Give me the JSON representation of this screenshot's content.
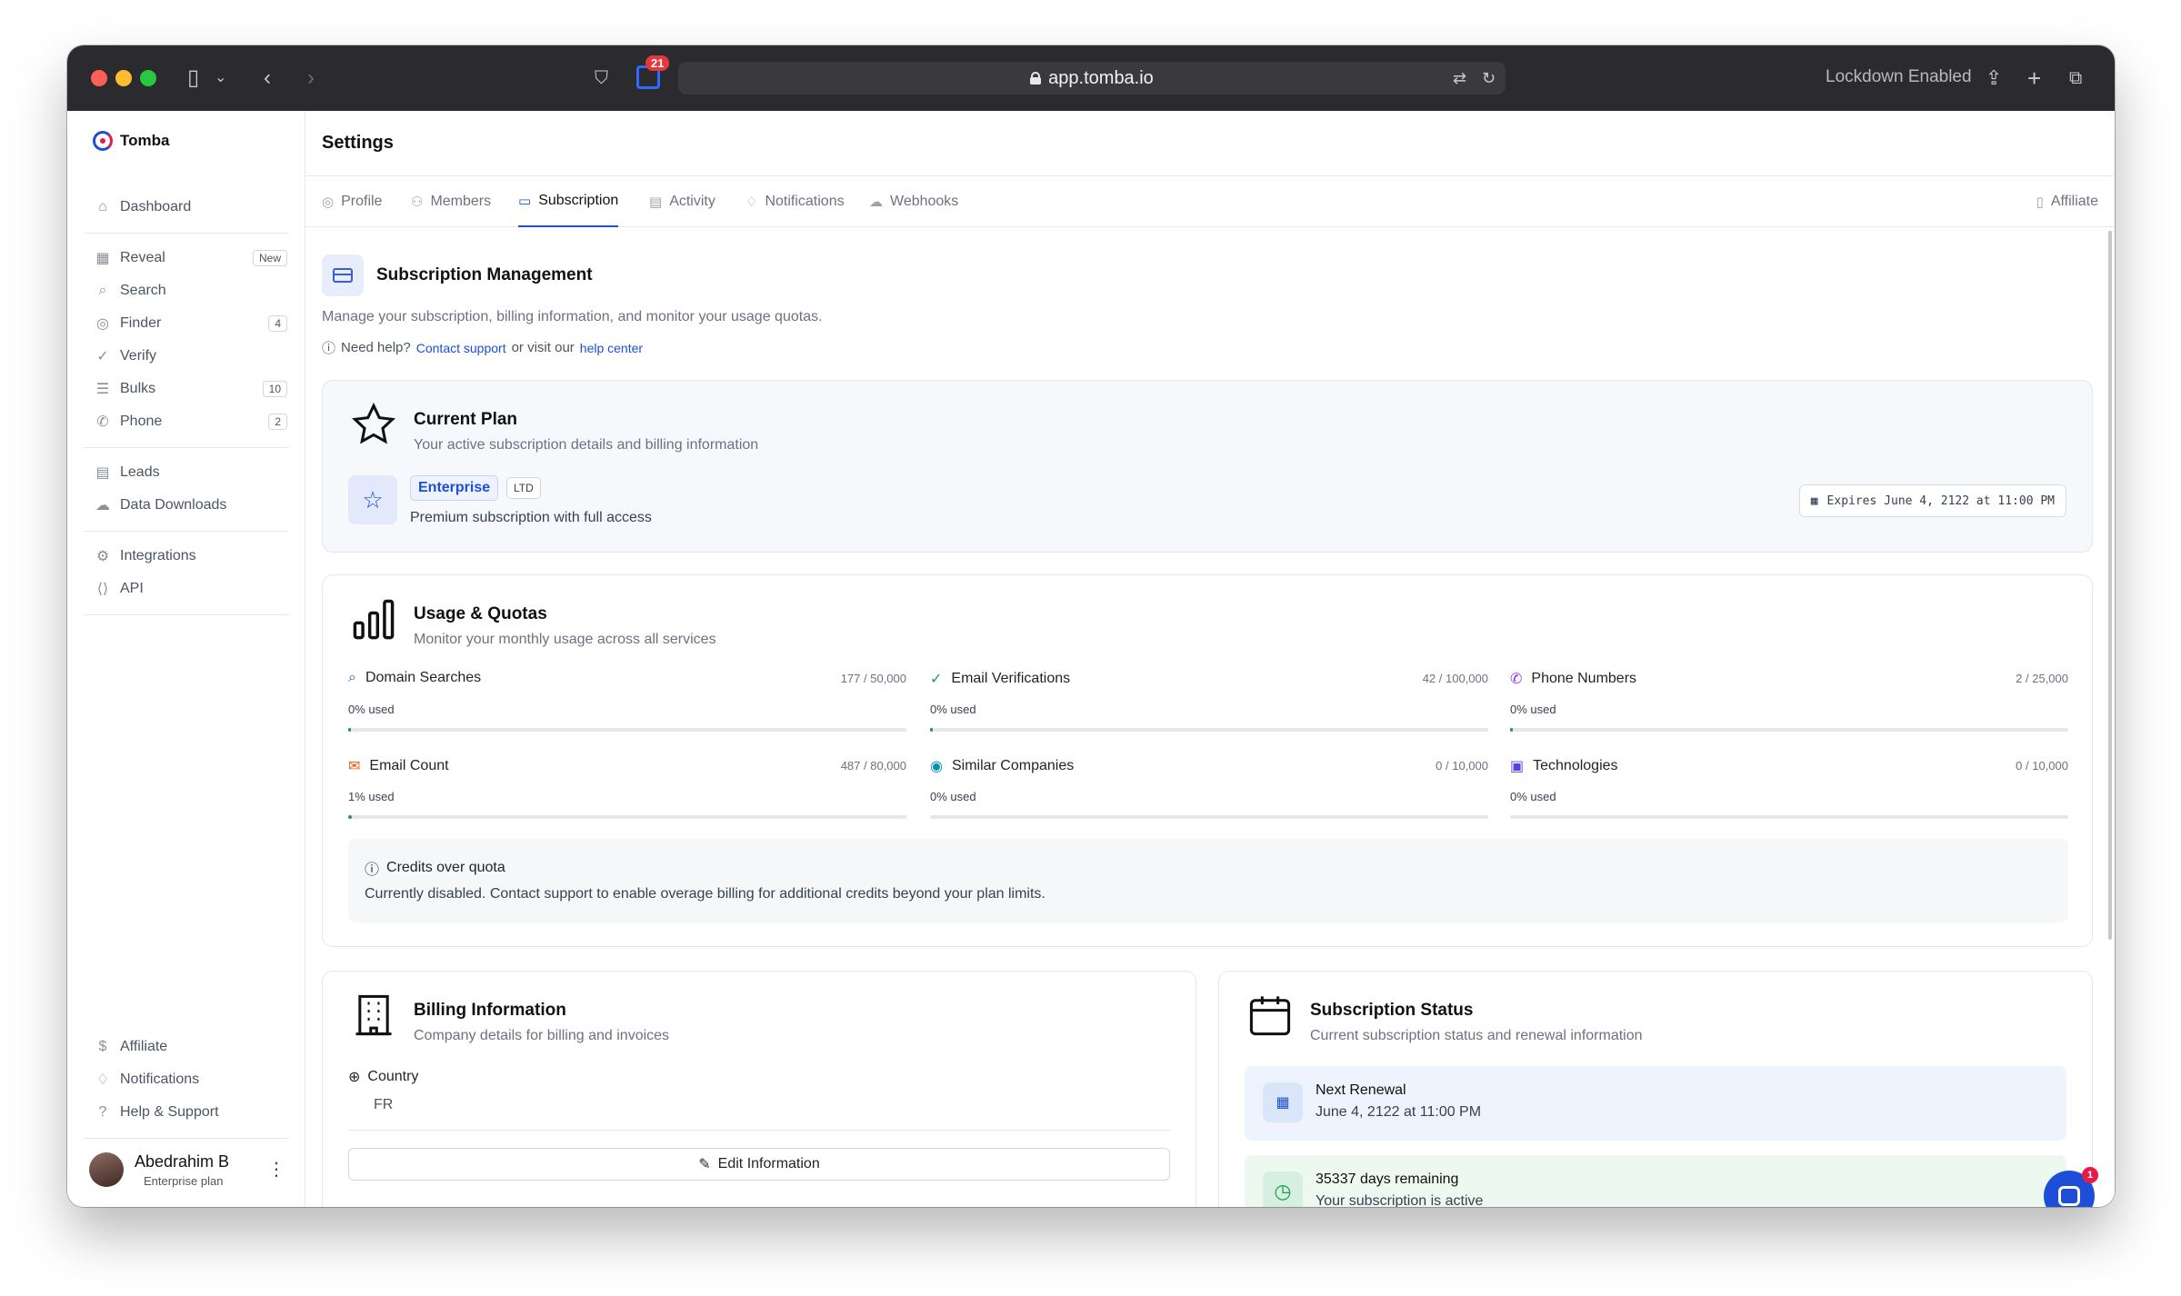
{
  "browser": {
    "url": "app.tomba.io",
    "extension_badge": "21",
    "lockdown": "Lockdown Enabled"
  },
  "sidebar": {
    "brand": "Tomba",
    "items": [
      {
        "label": "Dashboard",
        "icon": "home-icon"
      },
      {
        "label": "Reveal",
        "icon": "building-icon",
        "badge": "New"
      },
      {
        "label": "Search",
        "icon": "search-icon"
      },
      {
        "label": "Finder",
        "icon": "user-circle-icon",
        "badge": "4"
      },
      {
        "label": "Verify",
        "icon": "check-circle-icon"
      },
      {
        "label": "Bulks",
        "icon": "list-icon",
        "badge": "10"
      },
      {
        "label": "Phone",
        "icon": "phone-icon",
        "badge": "2"
      },
      {
        "label": "Leads",
        "icon": "file-icon"
      },
      {
        "label": "Data Downloads",
        "icon": "cloud-icon"
      },
      {
        "label": "Integrations",
        "icon": "plug-icon"
      },
      {
        "label": "API",
        "icon": "code-icon"
      }
    ],
    "bottom_items": [
      {
        "label": "Affiliate",
        "icon": "dollar-icon"
      },
      {
        "label": "Notifications",
        "icon": "bell-icon"
      },
      {
        "label": "Help & Support",
        "icon": "help-icon"
      }
    ],
    "user": {
      "name": "Abedrahim B",
      "plan": "Enterprise plan"
    }
  },
  "header": {
    "title": "Settings"
  },
  "tabs": [
    {
      "label": "Profile",
      "icon": "user-circle-icon"
    },
    {
      "label": "Members",
      "icon": "users-icon"
    },
    {
      "label": "Subscription",
      "icon": "credit-card-icon",
      "active": true
    },
    {
      "label": "Activity",
      "icon": "table-icon"
    },
    {
      "label": "Notifications",
      "icon": "bell-icon"
    },
    {
      "label": "Webhooks",
      "icon": "webhook-icon"
    }
  ],
  "affiliate_link": "Affiliate",
  "subscription": {
    "title": "Subscription Management",
    "description": "Manage your subscription, billing information, and monitor your usage quotas.",
    "help_prefix": "Need help?",
    "help_contact": "Contact support",
    "help_middle": "or visit our",
    "help_center": "help center"
  },
  "current_plan": {
    "title": "Current Plan",
    "subtitle": "Your active subscription details and billing information",
    "plan_name": "Enterprise",
    "plan_tag": "LTD",
    "plan_description": "Premium subscription with full access",
    "expires": "Expires June 4, 2122 at 11:00 PM"
  },
  "usage": {
    "title": "Usage & Quotas",
    "subtitle": "Monitor your monthly usage across all services",
    "quotas": [
      {
        "label": "Domain Searches",
        "value": "177 / 50,000",
        "used": "0% used",
        "fraction": 0.0035,
        "icon": "search-icon",
        "color": "#2563eb"
      },
      {
        "label": "Email Verifications",
        "value": "42 / 100,000",
        "used": "0% used",
        "fraction": 0.0004,
        "icon": "check-circle-icon",
        "color": "#16a34a"
      },
      {
        "label": "Phone Numbers",
        "value": "2 / 25,000",
        "used": "0% used",
        "fraction": 0.0001,
        "icon": "phone-icon",
        "color": "#9333ea"
      },
      {
        "label": "Email Count",
        "value": "487 / 80,000",
        "used": "1% used",
        "fraction": 0.006,
        "icon": "mail-icon",
        "color": "#ea580c"
      },
      {
        "label": "Similar Companies",
        "value": "0 / 10,000",
        "used": "0% used",
        "fraction": 0,
        "icon": "fingerprint-icon",
        "color": "#0891b2"
      },
      {
        "label": "Technologies",
        "value": "0 / 10,000",
        "used": "0% used",
        "fraction": 0,
        "icon": "cpu-icon",
        "color": "#4f46e5"
      }
    ],
    "credits_title": "Credits over quota",
    "credits_text": "Currently disabled. Contact support to enable overage billing for additional credits beyond your plan limits."
  },
  "billing": {
    "title": "Billing Information",
    "subtitle": "Company details for billing and invoices",
    "country_label": "Country",
    "country_value": "FR",
    "edit_label": "Edit Information"
  },
  "status": {
    "title": "Subscription Status",
    "subtitle": "Current subscription status and renewal information",
    "renewal_title": "Next Renewal",
    "renewal_date": "June 4, 2122 at 11:00 PM",
    "remaining_title": "35337 days remaining",
    "remaining_sub": "Your subscription is active"
  },
  "chat": {
    "badge": "1"
  }
}
